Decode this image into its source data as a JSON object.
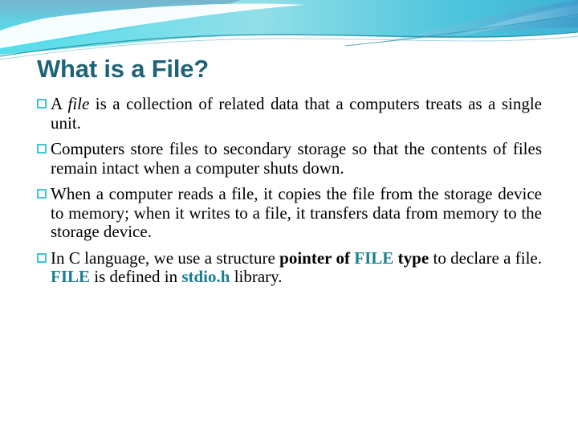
{
  "slide": {
    "title": "What is a File?",
    "title_color": "#1e6377",
    "accent_color": "#1b7e92",
    "bullet_marker_color": "#3cc6d6",
    "background_color": "#ffffff",
    "bullet_marker_glyph": "missing-glyph-box",
    "header_gradient": {
      "from": "#6fb2cc",
      "mid": "#4fd6e8",
      "to": "#ffffff"
    },
    "bullets": [
      {
        "id": "bullet-1",
        "text": "A file is a collection of related data that a computers treats as a single unit.",
        "runs": [
          {
            "text": "A ",
            "style": "normal"
          },
          {
            "text": "file",
            "style": "italic"
          },
          {
            "text": " is a collection of related data that a computers treats as a single unit.",
            "style": "normal"
          }
        ]
      },
      {
        "id": "bullet-2",
        "text": "Computers store files to secondary storage so that the contents of files remain intact when a computer shuts down.",
        "runs": [
          {
            "text": "Computers store files to secondary storage so that the contents of files remain intact when a computer shuts down.",
            "style": "normal"
          }
        ]
      },
      {
        "id": "bullet-3",
        "text": "When a computer reads a file, it copies the file from the storage device to memory; when it writes to a file, it transfers data from memory to the storage device.",
        "runs": [
          {
            "text": "When a computer reads a file, it copies the file from the storage device to memory; when it writes to a file, it transfers data from memory to the storage device.",
            "style": "normal"
          }
        ]
      },
      {
        "id": "bullet-4",
        "text": "In C language, we use a structure pointer of FILE type to declare a file. FILE is defined in stdio.h library.",
        "runs": [
          {
            "text": "In C language, we use a structure ",
            "style": "normal"
          },
          {
            "text": "pointer of ",
            "style": "bold"
          },
          {
            "text": "FILE",
            "style": "code"
          },
          {
            "text": " ",
            "style": "normal"
          },
          {
            "text": "type",
            "style": "bold"
          },
          {
            "text": " to declare a file. ",
            "style": "normal"
          },
          {
            "text": "FILE",
            "style": "code"
          },
          {
            "text": " is defined in ",
            "style": "normal"
          },
          {
            "text": "stdio.h",
            "style": "code"
          },
          {
            "text": " library.",
            "style": "normal"
          }
        ]
      }
    ]
  }
}
